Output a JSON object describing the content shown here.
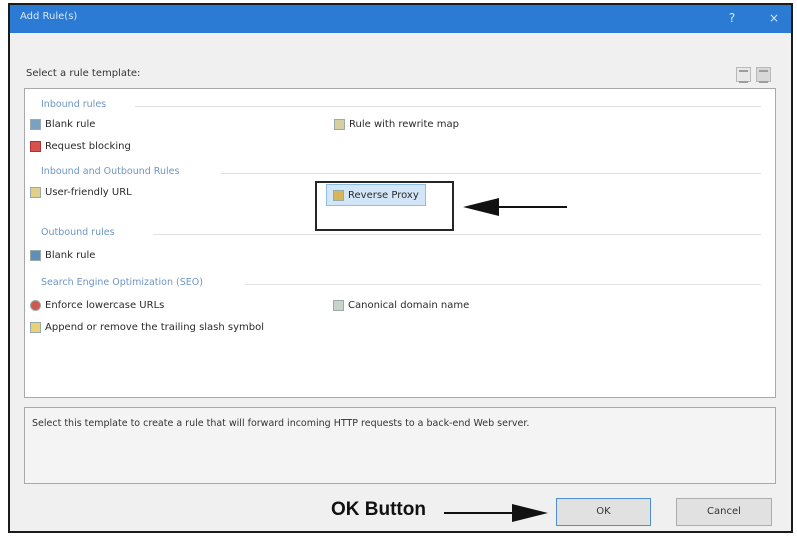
{
  "window": {
    "title": "Add Rule(s)",
    "help_button": "?",
    "close_button": "×"
  },
  "prompt": "Select a rule template:",
  "groups": [
    {
      "label": "Inbound rules"
    },
    {
      "label": "Inbound and Outbound Rules"
    },
    {
      "label": "Outbound rules"
    },
    {
      "label": "Search Engine Optimization (SEO)"
    }
  ],
  "items": {
    "blank_rule": "Blank rule",
    "request_blocking": "Request blocking",
    "rule_with_rewrite_map": "Rule with rewrite map",
    "user_friendly_url": "User-friendly URL",
    "reverse_proxy": "Reverse Proxy",
    "outbound_blank_rule": "Blank rule",
    "enforce_lowercase": "Enforce lowercase URLs",
    "canonical_domain": "Canonical domain name",
    "append_remove_slash": "Append or remove the trailing slash symbol"
  },
  "description": "Select this template to create a rule that will forward incoming HTTP requests to a back-end Web server.",
  "buttons": {
    "ok": "OK",
    "cancel": "Cancel"
  },
  "annotations": {
    "ok_label": "OK Button"
  }
}
